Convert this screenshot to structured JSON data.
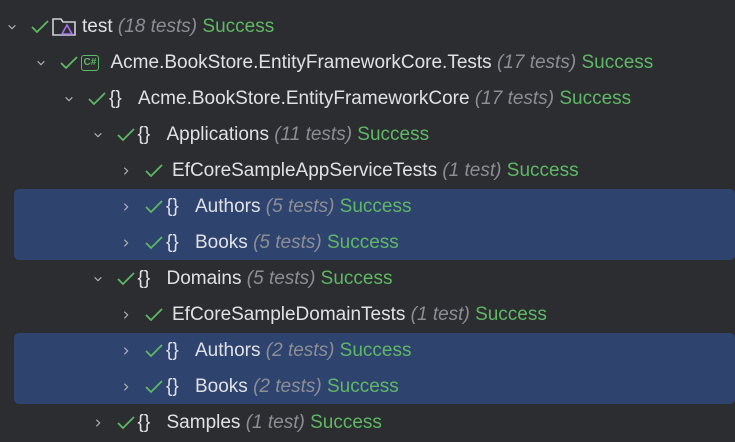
{
  "tree": [
    {
      "label": "test",
      "count": "(18 tests)",
      "status": "Success",
      "level": 0,
      "expanded": true,
      "icon": "folder-test-icon"
    },
    {
      "label": "Acme.BookStore.EntityFrameworkCore.Tests",
      "count": "(17 tests)",
      "status": "Success",
      "level": 1,
      "expanded": true,
      "icon": "csharp-project-icon",
      "icon_text": "C#"
    },
    {
      "label": "Acme.BookStore.EntityFrameworkCore",
      "count": "(17 tests)",
      "status": "Success",
      "level": 2,
      "expanded": true,
      "icon": "namespace-icon",
      "icon_text": "{}"
    },
    {
      "label": "Applications",
      "count": "(11 tests)",
      "status": "Success",
      "level": 3,
      "expanded": true,
      "icon": "namespace-icon",
      "icon_text": "{}"
    },
    {
      "label": "EfCoreSampleAppServiceTests",
      "count": "(1 test)",
      "status": "Success",
      "level": 4,
      "expanded": false,
      "icon": null
    },
    {
      "label": "Authors",
      "count": "(5 tests)",
      "status": "Success",
      "level": 4,
      "expanded": false,
      "icon": "namespace-icon",
      "icon_text": "{}",
      "selected": true
    },
    {
      "label": "Books",
      "count": "(5 tests)",
      "status": "Success",
      "level": 4,
      "expanded": false,
      "icon": "namespace-icon",
      "icon_text": "{}",
      "selected": true
    },
    {
      "label": "Domains",
      "count": "(5 tests)",
      "status": "Success",
      "level": 3,
      "expanded": true,
      "icon": "namespace-icon",
      "icon_text": "{}"
    },
    {
      "label": "EfCoreSampleDomainTests",
      "count": "(1 test)",
      "status": "Success",
      "level": 4,
      "expanded": false,
      "icon": null
    },
    {
      "label": "Authors",
      "count": "(2 tests)",
      "status": "Success",
      "level": 4,
      "expanded": false,
      "icon": "namespace-icon",
      "icon_text": "{}",
      "selected": true
    },
    {
      "label": "Books",
      "count": "(2 tests)",
      "status": "Success",
      "level": 4,
      "expanded": false,
      "icon": "namespace-icon",
      "icon_text": "{}",
      "selected": true
    },
    {
      "label": "Samples",
      "count": "(1 test)",
      "status": "Success",
      "level": 3,
      "expanded": false,
      "icon": "namespace-icon",
      "icon_text": "{}"
    }
  ],
  "colors": {
    "success": "#5fb865",
    "selection": "#2e436e",
    "background": "#2b2d30"
  }
}
